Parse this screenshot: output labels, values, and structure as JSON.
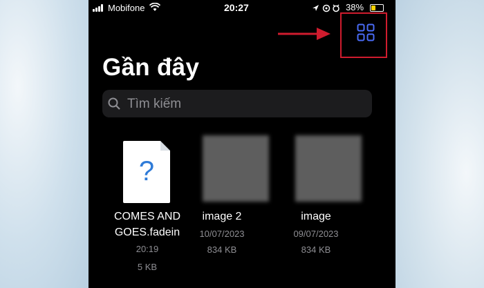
{
  "status_bar": {
    "carrier": "Mobifone",
    "time": "20:27",
    "battery": "38%"
  },
  "header": {
    "grid_button_icon": "grid-view-icon",
    "title": "Gần đây"
  },
  "search": {
    "placeholder": "Tìm kiếm"
  },
  "files": [
    {
      "name": "COMES AND GOES.fadein",
      "date": "20:19",
      "size": "5 KB",
      "thumb": "document-question-icon"
    },
    {
      "name": "image 2",
      "date": "10/07/2023",
      "size": "834 KB",
      "thumb": "blurred-image"
    },
    {
      "name": "image",
      "date": "09/07/2023",
      "size": "834 KB",
      "thumb": "blurred-image"
    }
  ],
  "annotation": {
    "arrow_color": "#d01c2e",
    "highlight_color": "#d01c2e"
  },
  "colors": {
    "accent": "#4a6cf7",
    "background": "#000000",
    "search_bg": "#1c1c1e",
    "meta_text": "#8e8e93"
  }
}
